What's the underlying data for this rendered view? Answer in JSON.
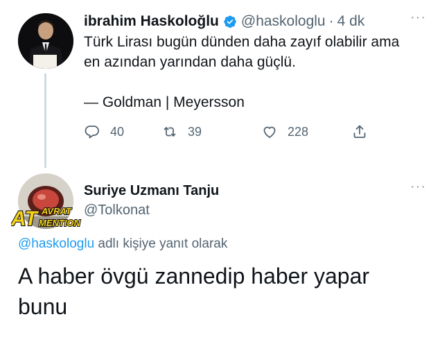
{
  "tweet": {
    "author_name": "ibrahim Haskoloğlu",
    "author_handle": "@haskologlu",
    "separator": "·",
    "time": "4 dk",
    "more": "···",
    "text": "Türk Lirası bugün dünden daha zayıf olabilir ama en azından yarından daha güçlü.\n\n— Goldman | Meyersson",
    "replies": "40",
    "retweets": "39",
    "likes": "228",
    "verified_color": "#1d9bf0"
  },
  "reply": {
    "author_name": "Suriye Uzmanı Tanju",
    "author_handle": "@Tolkonat",
    "more": "···",
    "badge_text_top": "AVRAT",
    "badge_text_bottom": "MENTION",
    "badge_letters": "AT",
    "reply_to_handle": "@haskologlu",
    "reply_to_suffix": " adlı kişiye yanıt olarak",
    "text": "A haber övgü zannedip haber yapar bunu"
  },
  "icons": {
    "reply": "comment-icon",
    "retweet": "retweet-icon",
    "like": "heart-icon",
    "share": "share-icon",
    "verified": "verified-badge-icon"
  },
  "colors": {
    "accent": "#1d9bf0",
    "secondary_text": "#536471",
    "thread_line": "#cfd9de",
    "badge_yellow": "#f7d21a"
  }
}
